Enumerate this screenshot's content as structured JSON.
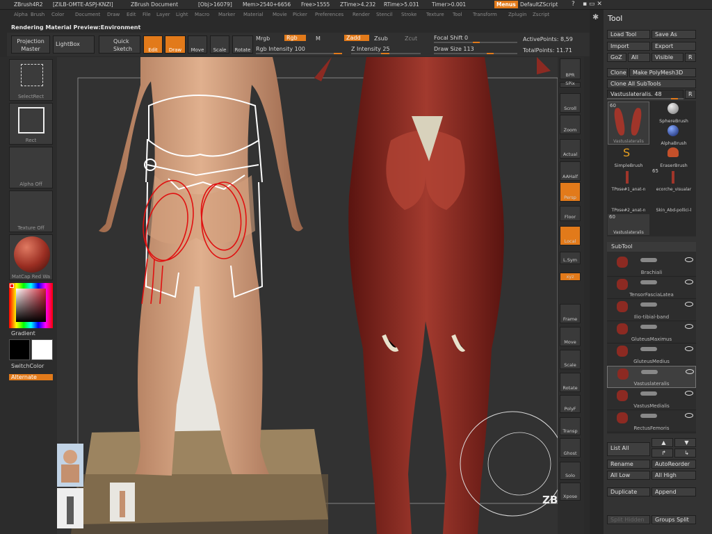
{
  "title_bar": {
    "app": "ZBrush4R2",
    "id": "[ZILB-OMTE-ASPJ-KNZI]",
    "doc": "ZBrush Document",
    "obj": "[Obj>16079]",
    "mem": "Mem>2540+6656",
    "free": "Free>1555",
    "ztime": "ZTime>4.232",
    "rtime": "RTime>5.031",
    "timer": "Timer>0.001",
    "menus": "Menus",
    "script": "DefaultZScript"
  },
  "menu_items": [
    "Alpha",
    "Brush",
    "Color",
    "Document",
    "Draw",
    "Edit",
    "File",
    "Layer",
    "Light",
    "Macro",
    "Marker",
    "Material",
    "Movie",
    "Picker",
    "Preferences",
    "Render",
    "Stencil",
    "Stroke",
    "Texture",
    "Tool",
    "Transform",
    "Zplugin",
    "Zscript"
  ],
  "status": "Rendering Material Preview:Environment",
  "toolbar": {
    "projection_master": "Projection Master",
    "lightbox": "LightBox",
    "quick_sketch": "Quick Sketch",
    "edit": "Edit",
    "draw": "Draw",
    "move": "Move",
    "scale": "Scale",
    "rotate": "Rotate",
    "mrgb": "Mrgb",
    "rgb": "Rgb",
    "m": "M",
    "rgb_intensity": "Rgb Intensity 100",
    "zadd": "Zadd",
    "zsub": "Zsub",
    "zcut": "Zcut",
    "z_intensity": "Z Intensity 25",
    "focal_shift": "Focal Shift 0",
    "draw_size": "Draw Size 113",
    "active_points": "ActivePoints: 8,59",
    "total_points": "TotalPoints: 11.71"
  },
  "left_shelf": {
    "selectrect": "SelectRect",
    "rect": "Rect",
    "alpha_off": "Alpha Off",
    "texture_off": "Texture Off",
    "matcap": "MatCap Red Wa",
    "gradient": "Gradient",
    "switchcolor": "SwitchColor",
    "alternate": "Alternate"
  },
  "right_shelf": [
    "BPR",
    "SPix",
    "Scroll",
    "Zoom",
    "Actual",
    "AAHalf",
    "Persp",
    "Floor",
    "Local",
    "L.Sym",
    "xyz",
    "Frame",
    "Move",
    "Scale",
    "Rotate",
    "PolyF",
    "Transp",
    "Ghost",
    "Solo",
    "Xpose"
  ],
  "tool_palette": {
    "title": "Tool",
    "load_tool": "Load Tool",
    "save_as": "Save As",
    "import": "Import",
    "export": "Export",
    "goz": "GoZ",
    "all": "All",
    "visible": "Visible",
    "r": "R",
    "clone": "Clone",
    "make_polymesh": "Make PolyMesh3D",
    "clone_all": "Clone All SubTools",
    "current_tool": "Vastuslateralis. 48",
    "tool_count": "60",
    "thumb1": "Vastuslateralis",
    "sphere_brush": "SphereBrush",
    "alpha_brush": "AlphaBrush",
    "simple_brush": "SimpleBrush",
    "eraser_brush": "EraserBrush",
    "count65": "65",
    "tpose1": "TPose#1_anat-n",
    "ecorche": "ecorche_visualar",
    "tpose2": "TPose#2_anat-n",
    "skin": "Skin_Abd-pollici-l",
    "count60": "60",
    "thumb_last": "Vastuslateralis"
  },
  "subtool": {
    "title": "SubTool",
    "items": [
      "Brachiali",
      "TensorFasciaLatea",
      "Ilio-tibial-band",
      "GluteusMaximus",
      "GluteusMedius",
      "Vastuslateralis",
      "VastusMedialis",
      "RectusFemoris"
    ],
    "list_all": "List All",
    "rename": "Rename",
    "auto_reorder": "AutoReorder",
    "all_low": "All Low",
    "all_high": "All High",
    "duplicate": "Duplicate",
    "append": "Append",
    "split_hidden": "Split Hidden",
    "groups_split": "Groups Split"
  },
  "watermark": "ZBRUSH WORKSHOPS",
  "colors": {
    "accent": "#e27a1a",
    "panel": "#3a3a3a",
    "muscle": "#8c2a22"
  }
}
